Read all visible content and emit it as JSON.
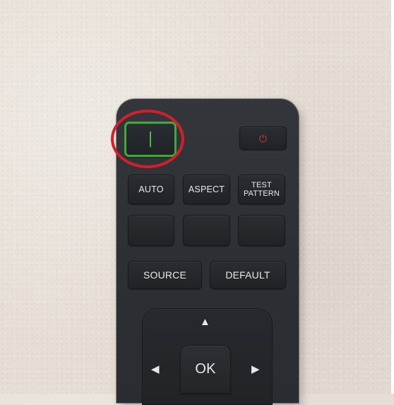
{
  "remote": {
    "power_on_icon": "power-on-bar-icon",
    "power_off_icon": "power-off-icon",
    "buttons": {
      "auto": "AUTO",
      "aspect": "ASPECT",
      "test_line1": "TEST",
      "test_line2": "PATTERN",
      "source": "SOURCE",
      "default": "DEFAULT",
      "ok": "OK"
    },
    "arrows": {
      "up": "▲",
      "left": "◀",
      "right": "▶"
    },
    "power_glyph": "⏻"
  },
  "colors": {
    "highlight_ring": "#d21f2c",
    "power_on_outline": "#43a83c",
    "power_off_symbol": "#d5382f",
    "remote_body": "#2c3034",
    "wall": "#e6ded5"
  }
}
